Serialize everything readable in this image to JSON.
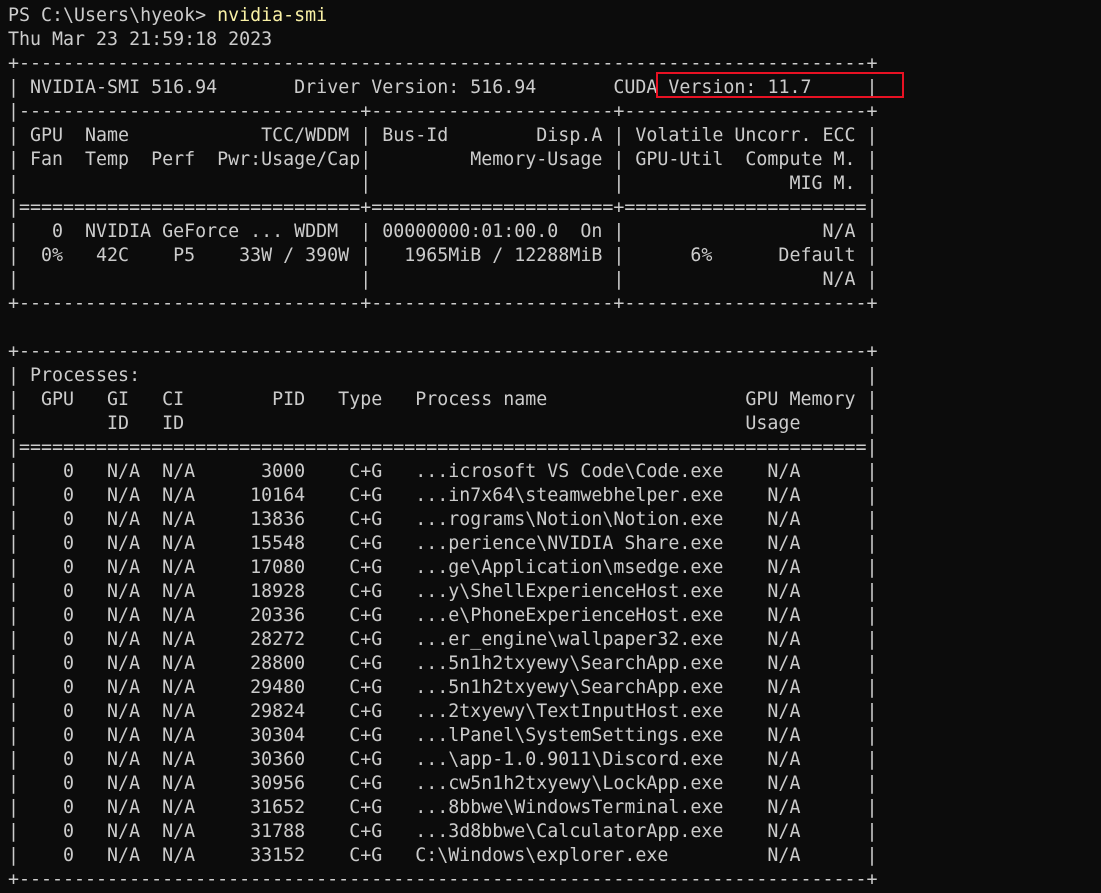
{
  "terminal": {
    "prompt": "PS C:\\Users\\hyeok> ",
    "command": "nvidia-smi",
    "timestamp": "Thu Mar 23 21:59:18 2023",
    "highlight_color": "#e81123",
    "border_top": "+-----------------------------------------------------------------------------+",
    "smi_version": "NVIDIA-SMI 516.94",
    "driver_version": "Driver Version: 516.94",
    "cuda_version": "CUDA Version: 11.7",
    "sep_header": "|-------------------------------+----------------------+----------------------+",
    "gpu_header_1": "| GPU  Name            TCC/WDDM | Bus-Id        Disp.A | Volatile Uncorr. ECC |",
    "gpu_header_2": "| Fan  Temp  Perf  Pwr:Usage/Cap|         Memory-Usage | GPU-Util  Compute M. |",
    "gpu_header_3": "|                               |                      |               MIG M. |",
    "sep_double": "|===============================+======================+======================|",
    "gpu_row_1": "|   0  NVIDIA GeForce ... WDDM  | 00000000:01:00.0  On |                  N/A |",
    "gpu_row_2": "|  0%   42C    P5    33W / 390W |   1965MiB / 12288MiB |      6%      Default |",
    "gpu_row_3": "|                               |                      |                  N/A |",
    "sep_gpu_bottom": "+-------------------------------+----------------------+----------------------+",
    "blank": "",
    "proc_header_1": "| Processes:                                                                  |",
    "proc_header_2": "|  GPU   GI   CI        PID   Type   Process name                  GPU Memory |",
    "proc_header_3": "|        ID   ID                                                   Usage      |",
    "proc_sep_double": "|=============================================================================|",
    "processes": [
      "|    0   N/A  N/A      3000    C+G   ...icrosoft VS Code\\Code.exe    N/A      |",
      "|    0   N/A  N/A     10164    C+G   ...in7x64\\steamwebhelper.exe    N/A      |",
      "|    0   N/A  N/A     13836    C+G   ...rograms\\Notion\\Notion.exe    N/A      |",
      "|    0   N/A  N/A     15548    C+G   ...perience\\NVIDIA Share.exe    N/A      |",
      "|    0   N/A  N/A     17080    C+G   ...ge\\Application\\msedge.exe    N/A      |",
      "|    0   N/A  N/A     18928    C+G   ...y\\ShellExperienceHost.exe    N/A      |",
      "|    0   N/A  N/A     20336    C+G   ...e\\PhoneExperienceHost.exe    N/A      |",
      "|    0   N/A  N/A     28272    C+G   ...er_engine\\wallpaper32.exe    N/A      |",
      "|    0   N/A  N/A     28800    C+G   ...5n1h2txyewy\\SearchApp.exe    N/A      |",
      "|    0   N/A  N/A     29480    C+G   ...5n1h2txyewy\\SearchApp.exe    N/A      |",
      "|    0   N/A  N/A     29824    C+G   ...2txyewy\\TextInputHost.exe    N/A      |",
      "|    0   N/A  N/A     30304    C+G   ...lPanel\\SystemSettings.exe    N/A      |",
      "|    0   N/A  N/A     30360    C+G   ...\\app-1.0.9011\\Discord.exe    N/A      |",
      "|    0   N/A  N/A     30956    C+G   ...cw5n1h2txyewy\\LockApp.exe    N/A      |",
      "|    0   N/A  N/A     31652    C+G   ...8bbwe\\WindowsTerminal.exe    N/A      |",
      "|    0   N/A  N/A     31788    C+G   ...3d8bbwe\\CalculatorApp.exe    N/A      |",
      "|    0   N/A  N/A     33152    C+G   C:\\Windows\\explorer.exe         N/A      |"
    ],
    "border_bottom": "+-----------------------------------------------------------------------------+"
  }
}
